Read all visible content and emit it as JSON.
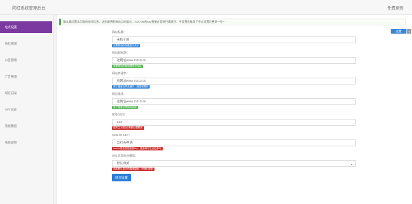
{
  "header": {
    "title": "防红系统管理后台",
    "right_link": "免费更新"
  },
  "sidebar": {
    "items": [
      {
        "label": "站点设置",
        "active": true
      },
      {
        "label": "防红管理",
        "active": false
      },
      {
        "label": "公告管理",
        "active": false
      },
      {
        "label": "广告管理",
        "active": false
      },
      {
        "label": "域名记录",
        "active": false
      },
      {
        "label": "API 记录",
        "active": false
      },
      {
        "label": "系统教程",
        "active": false
      },
      {
        "label": "系统说明",
        "active": false
      }
    ]
  },
  "notice": {
    "text": "请认真设置本页面的各项信息，这些都将影响站点的展示，SUO.IM的key直接去官网开通就行，不设置也能用了不过设置后更好一些~"
  },
  "float_buttons": {
    "primary": "设置",
    "secondary": "×"
  },
  "form": {
    "fields": [
      {
        "label": "网站标题：",
        "value": "米粒小屋",
        "tag": "设置网站的标题显示文字",
        "tag_color": "#3a87d6"
      },
      {
        "label": "网站副标题：",
        "value": "短网址www.m213.cn",
        "tag": "设置网站的副标题显示内容",
        "tag_color": "#5cb85c"
      },
      {
        "label": "网站关键字：",
        "value": "短网址www.m213.cn",
        "tag": "用于搜索引擎关键字，用逗号隔开",
        "tag_color": "#3a87d6"
      },
      {
        "label": "网站描述：",
        "value": "短网址www.m213.cn",
        "tag": "用于搜索引擎网站描述",
        "tag_color": "#5cb85c"
      },
      {
        "label": "联系QQ号：",
        "value": "123",
        "tag": "填写主人的QQ号码以便联系",
        "tag_color": "#c9302c"
      },
      {
        "label": "SUO.IM KEY：",
        "value": "自行去申请",
        "tag": "suo.im提供的短链接key，直接填写在此处即可",
        "tag_color": "#c9302c"
      },
      {
        "label": "URL页面显示模版：",
        "value": "默认样式",
        "tag": "选择默认显示的跳转模板，可随时调整",
        "tag_color": "#c9302c",
        "is_select": true
      }
    ],
    "submit_label": "提交设置"
  }
}
